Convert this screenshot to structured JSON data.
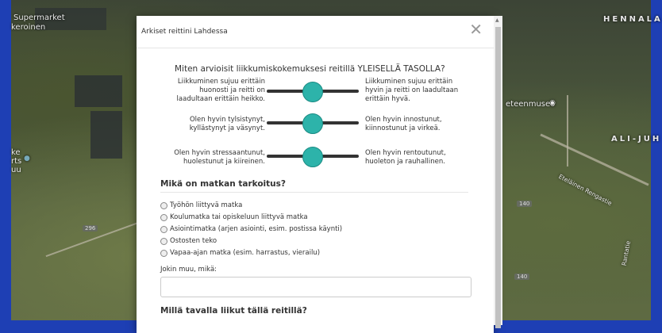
{
  "map": {
    "labels": {
      "supermarket": "Supermarket",
      "kiroinen": "keroinen",
      "hennala": "HENNALA",
      "museo": "eteenmuseo",
      "alijuh": "ALI-JUH",
      "ke": "ke",
      "rts": "rts",
      "uu": "uu",
      "road296": "296",
      "road140a": "140",
      "road140b": "140",
      "etelainen": "Eteläinen Rengastie",
      "rantatie": "Rantatie"
    }
  },
  "modal": {
    "title": "Arkiset reittini Lahdessa",
    "close": "✕",
    "q1_title": "Miten arvioisit liikkumiskokemuksesi reitillä YLEISELLÄ TASOLLA?",
    "sliders": [
      {
        "left": "Liikkuminen sujuu erittäin huonosti ja reitti on laadultaan erittäin heikko.",
        "right": "Liikkuminen sujuu erittäin hyvin ja reitti on laadultaan erittäin hyvä.",
        "value": 0.5
      },
      {
        "left": "Olen hyvin tylsistynyt, kyllästynyt ja väsynyt.",
        "right": "Olen hyvin innostunut, kiinnostunut ja virkeä.",
        "value": 0.5
      },
      {
        "left": "Olen hyvin stressaantunut, huolestunut ja kiireinen.",
        "right": "Olen hyvin rentoutunut, huoleton ja rauhallinen.",
        "value": 0.5
      }
    ],
    "q2_title": "Mikä on matkan tarkoitus?",
    "options": [
      "Työhön liittyvä matka",
      "Koulumatka tai opiskeluun liittyvä matka",
      "Asiointimatka (arjen asiointi, esim. postissa käynti)",
      "Ostosten teko",
      "Vapaa-ajan matka (esim. harrastus, vierailu)"
    ],
    "other_label": "Jokin muu, mikä:",
    "other_value": "",
    "q3_title": "Millä tavalla liikut tällä reitillä?"
  }
}
